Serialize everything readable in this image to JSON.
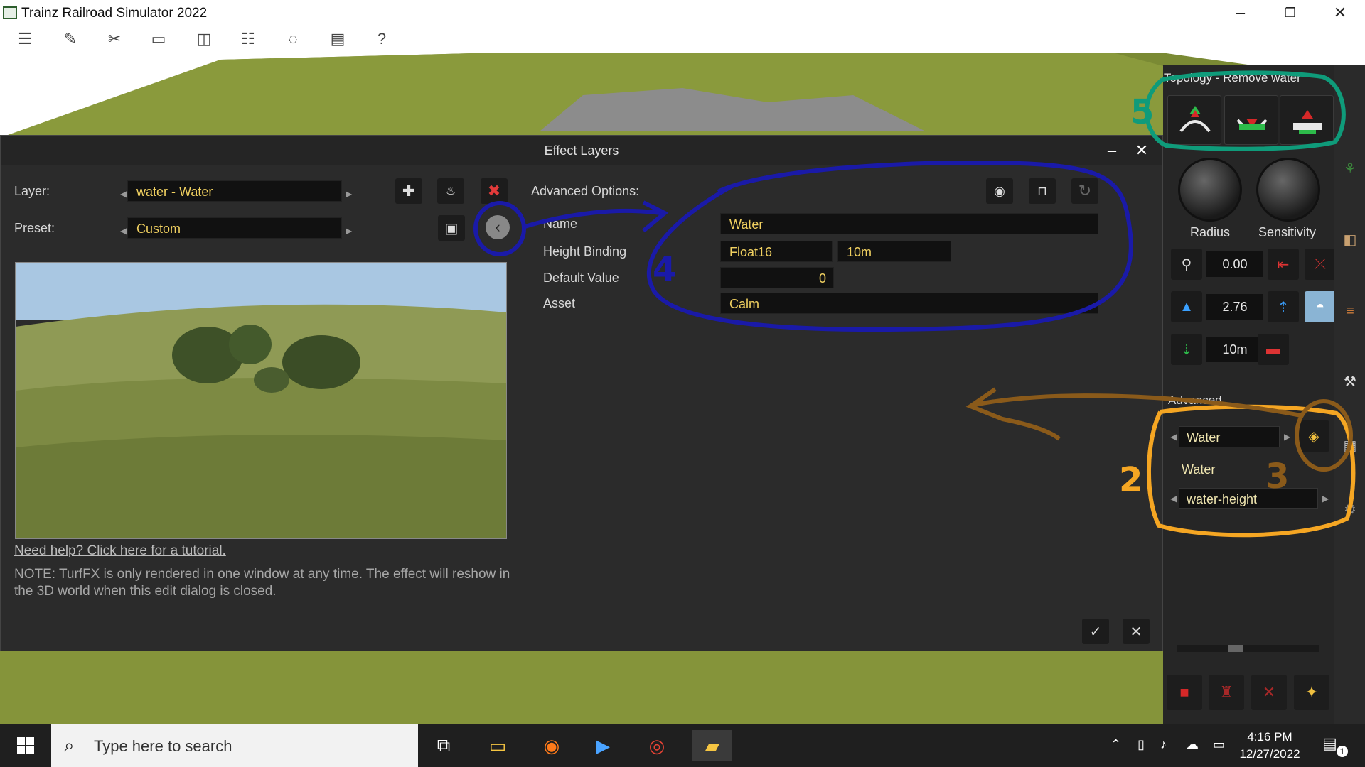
{
  "window": {
    "title": "Trainz Railroad Simulator 2022",
    "minimize": "–",
    "maximize": "❐",
    "close": "✕"
  },
  "toolbar": {
    "icons": [
      "menu-icon",
      "edit-icon",
      "tools-icon",
      "monitor-icon",
      "camera-icon",
      "people-icon",
      "chat-icon",
      "layers-icon",
      "help-icon"
    ]
  },
  "dialog": {
    "title": "Effect Layers",
    "minimize": "–",
    "close": "✕",
    "layer_label": "Layer:",
    "layer_value": "water - Water",
    "preset_label": "Preset:",
    "preset_value": "Custom",
    "advanced_label": "Advanced Options:",
    "fields": {
      "name_label": "Name",
      "name_value": "Water",
      "height_label": "Height Binding",
      "height_type": "Float16",
      "height_value": "10m",
      "default_label": "Default Value",
      "default_value": "0",
      "asset_label": "Asset",
      "asset_value": "Calm"
    },
    "help_link": "Need help? Click here for a tutorial.",
    "note": "NOTE: TurfFX is only rendered in one window at any time. The effect will reshow in the 3D world when this edit dialog is closed.",
    "ok": "✓",
    "cancel": "✕"
  },
  "panel": {
    "title": "Topology - Remove water",
    "radius_label": "Radius",
    "sensitivity_label": "Sensitivity",
    "height_value": "0.00",
    "water_value": "2.76",
    "step_value": "10m",
    "advanced_label": "Advanced",
    "layer_value": "Water",
    "layer_name": "Water",
    "binding_value": "water-height"
  },
  "annotations": [
    "2",
    "3",
    "4",
    "5"
  ],
  "annotation_colors": {
    "blue": "#1a1aa8",
    "orange": "#f5a623",
    "brown": "#8a5a1a",
    "teal": "#0f9b7a"
  },
  "taskbar": {
    "search_placeholder": "Type here to search",
    "time": "4:16 PM",
    "date": "12/27/2022",
    "notification_count": "1"
  }
}
